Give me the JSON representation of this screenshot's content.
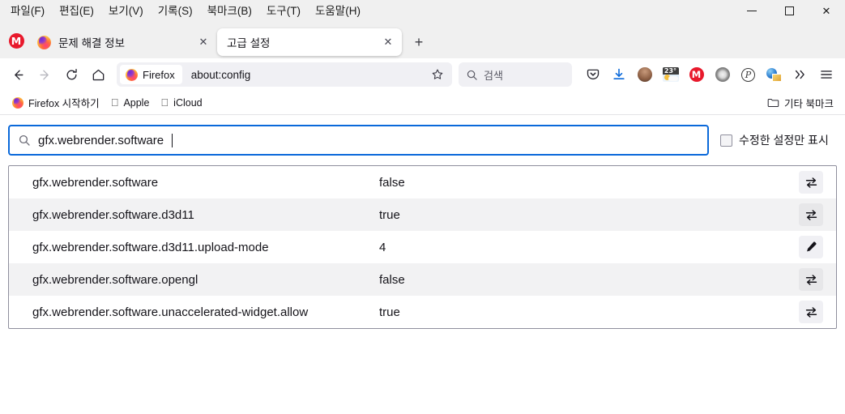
{
  "menubar": {
    "items": [
      {
        "label": "파일(F)",
        "name": "menu-file"
      },
      {
        "label": "편집(E)",
        "name": "menu-edit"
      },
      {
        "label": "보기(V)",
        "name": "menu-view"
      },
      {
        "label": "기록(S)",
        "name": "menu-history"
      },
      {
        "label": "북마크(B)",
        "name": "menu-bookmarks"
      },
      {
        "label": "도구(T)",
        "name": "menu-tools"
      },
      {
        "label": "도움말(H)",
        "name": "menu-help"
      }
    ]
  },
  "window_controls": {
    "minimize": "minimize-icon",
    "maximize": "maximize-icon",
    "close": "✕"
  },
  "tabs": {
    "lead_icon": "gmail-icon",
    "lead_icon_label": "M",
    "items": [
      {
        "title": "문제 해결 정보",
        "active": false,
        "favicon": "firefox-icon",
        "close": "✕"
      },
      {
        "title": "고급 설정",
        "active": true,
        "favicon": "none",
        "close": "✕"
      }
    ],
    "new_tab": "+"
  },
  "toolbar": {
    "back": "←",
    "forward": "→",
    "reload": "⟳",
    "home": "⌂",
    "url_chip_label": "Firefox",
    "url": "about:config",
    "bookmark_star": "☆",
    "search_placeholder": "검색",
    "search_icon": "search-icon",
    "icons": [
      {
        "name": "pocket-icon",
        "label": "pocket"
      },
      {
        "name": "downloads-icon",
        "label": "downloads"
      },
      {
        "name": "account-avatar",
        "label": "account"
      },
      {
        "name": "weather-extension-icon",
        "label": "23°"
      },
      {
        "name": "gmail-extension-icon",
        "label": "M"
      },
      {
        "name": "film-reel-extension-icon",
        "label": "reel"
      },
      {
        "name": "pinterest-extension-icon",
        "label": "P"
      },
      {
        "name": "image-tools-extension-icon",
        "label": "globe"
      },
      {
        "name": "overflow-chevron-icon",
        "label": "≫"
      },
      {
        "name": "app-menu-icon",
        "label": "≡"
      }
    ]
  },
  "bookmarks_bar": {
    "items": [
      {
        "label": "Firefox 시작하기",
        "icon": "firefox-icon"
      },
      {
        "label": "Apple",
        "icon": "apple-icon"
      },
      {
        "label": "iCloud",
        "icon": "apple-icon"
      }
    ],
    "other_bookmarks": "기타 북마크",
    "folder_icon": "folder-icon"
  },
  "aboutconfig": {
    "search_value": "gfx.webrender.software",
    "search_icon": "search-icon",
    "show_modified_label": "수정한 설정만 표시",
    "show_modified_checked": false,
    "rows": [
      {
        "name": "gfx.webrender.software",
        "value": "false",
        "action": "toggle-icon"
      },
      {
        "name": "gfx.webrender.software.d3d11",
        "value": "true",
        "action": "toggle-icon"
      },
      {
        "name": "gfx.webrender.software.d3d11.upload-mode",
        "value": "4",
        "action": "edit-icon"
      },
      {
        "name": "gfx.webrender.software.opengl",
        "value": "false",
        "action": "toggle-icon"
      },
      {
        "name": "gfx.webrender.software.unaccelerated-widget.allow",
        "value": "true",
        "action": "toggle-icon"
      }
    ]
  },
  "colors": {
    "accent": "#0a69da",
    "chrome_bg": "#f0f0f0",
    "row_alt": "#f2f2f3"
  }
}
